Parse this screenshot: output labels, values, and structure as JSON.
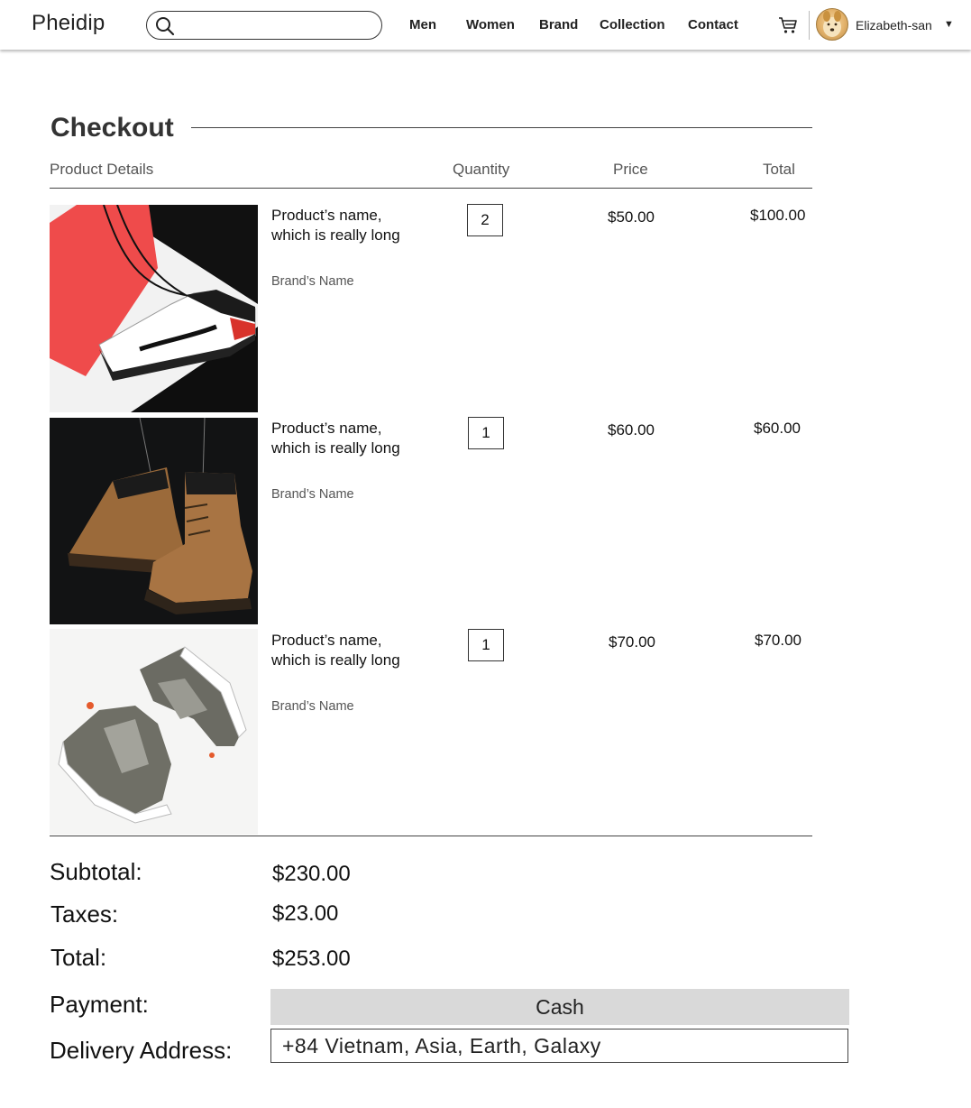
{
  "header": {
    "logo": "Pheidip",
    "search": {
      "placeholder": "",
      "value": ""
    },
    "nav": [
      "Men",
      "Women",
      "Brand",
      "Collection",
      "Contact"
    ],
    "user": {
      "name": "Elizabeth-san"
    }
  },
  "checkout": {
    "title": "Checkout",
    "columns": {
      "product": "Product Details",
      "quantity": "Quantity",
      "price": "Price",
      "total": "Total"
    },
    "items": [
      {
        "name": "Product’s name, which is really long",
        "brand": "Brand’s Name",
        "quantity": "2",
        "price": "$50.00",
        "total": "$100.00"
      },
      {
        "name": "Product’s name, which is really long",
        "brand": "Brand’s Name",
        "quantity": "1",
        "price": "$60.00",
        "total": "$60.00"
      },
      {
        "name": "Product’s name, which is really long",
        "brand": "Brand’s Name",
        "quantity": "1",
        "price": "$70.00",
        "total": "$70.00"
      }
    ]
  },
  "summary": {
    "subtotal_label": "Subtotal:",
    "subtotal": "$230.00",
    "taxes_label": "Taxes:",
    "taxes": "$23.00",
    "total_label": "Total:",
    "total": "$253.00",
    "payment_label": "Payment:",
    "payment": "Cash",
    "address_label": "Delivery Address:",
    "address": "+84 Vietnam, Asia, Earth, Galaxy"
  },
  "colors": {
    "text": "#222222",
    "payment_bg": "#d9d9d9",
    "line": "#444444"
  }
}
